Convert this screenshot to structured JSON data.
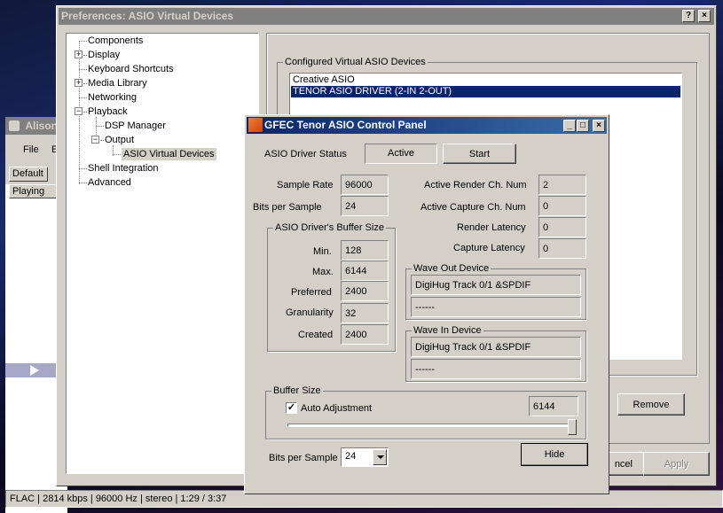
{
  "colors": {
    "title_active": "#0a246a",
    "title_inactive": "#808080",
    "dialog_bg": "#d4d0c8",
    "selection": "#0a246a"
  },
  "background_app": {
    "title": "Alison",
    "menu_file": "File",
    "menu_e": "E",
    "tab_default": "Default",
    "col_playing": "Playing",
    "status": "FLAC | 2814 kbps | 96000 Hz | stereo | 1:29 / 3:37",
    "play_marker_icon": "play-triangle"
  },
  "prefs": {
    "title": "Preferences: ASIO Virtual Devices",
    "help_btn": "?",
    "close_btn": "×",
    "tree": [
      {
        "label": "Components"
      },
      {
        "label": "Display",
        "expander": "+"
      },
      {
        "label": "Keyboard Shortcuts"
      },
      {
        "label": "Media Library",
        "expander": "+"
      },
      {
        "label": "Networking"
      },
      {
        "label": "Playback",
        "expander": "−"
      },
      {
        "label": "DSP Manager"
      },
      {
        "label": "Output",
        "expander": "−"
      },
      {
        "label": "ASIO Virtual Devices"
      },
      {
        "label": "Shell Integration"
      },
      {
        "label": "Advanced"
      }
    ],
    "group_title": "Configured Virtual ASIO Devices",
    "devices": [
      "Creative ASIO",
      "TENOR ASIO DRIVER (2-IN 2-OUT)"
    ],
    "remove_btn": "Remove",
    "cancel_btn": "ncel",
    "apply_btn": "Apply"
  },
  "panel": {
    "title": "GFEC Tenor ASIO Control Panel",
    "driver_status_label": "ASIO Driver Status",
    "status_value": "Active",
    "start_btn": "Start",
    "sample_rate_label": "Sample Rate",
    "sample_rate": "96000",
    "bits_label": "Bits per Sample",
    "bits": "24",
    "buffer_group": "ASIO Driver's Buffer Size",
    "min_label": "Min.",
    "min": "128",
    "max_label": "Max.",
    "max": "6144",
    "pref_label": "Preferred",
    "pref": "2400",
    "gran_label": "Granularity",
    "gran": "32",
    "created_label": "Created",
    "created": "2400",
    "render_ch_label": "Active Render Ch. Num",
    "render_ch": "2",
    "capture_ch_label": "Active Capture Ch. Num",
    "capture_ch": "0",
    "render_lat_label": "Render Latency",
    "render_lat": "0",
    "capture_lat_label": "Capture Latency",
    "capture_lat": "0",
    "wave_out_group": "Wave Out Device",
    "wave_out_1": "DigiHug Track 0/1 &SPDIF",
    "wave_out_2": "------",
    "wave_in_group": "Wave In Device",
    "wave_in_1": "DigiHug Track 0/1 &SPDIF",
    "wave_in_2": "------",
    "bufsize_group": "Buffer Size",
    "auto_adj_label": "Auto Adjustment",
    "auto_adj_checked": true,
    "bufsize_value": "6144",
    "bits_select_label": "Bits per Sample",
    "bits_select_value": "24",
    "hide_btn": "Hide",
    "min_btn": "_",
    "max_btn": "□",
    "close_btn": "×"
  }
}
